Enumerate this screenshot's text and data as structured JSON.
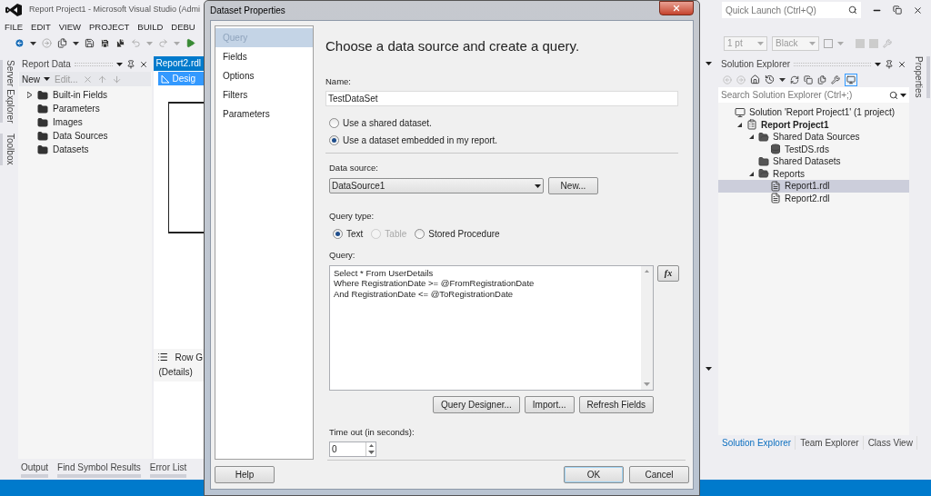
{
  "vs": {
    "title": "Report Project1 - Microsoft Visual Studio (Admi",
    "menu": [
      "FILE",
      "EDIT",
      "VIEW",
      "PROJECT",
      "BUILD",
      "DEBU"
    ],
    "quick_launch": {
      "placeholder": "Quick Launch (Ctrl+Q)"
    },
    "font_size": "1 pt",
    "font_color": "Black",
    "left_tabs": [
      "Server Explorer",
      "Toolbox"
    ],
    "report_data": {
      "title": "Report Data",
      "new": "New",
      "edit": "Edit...",
      "items": [
        {
          "label": "Built-in Fields",
          "expandable": true
        },
        {
          "label": "Parameters",
          "expandable": false
        },
        {
          "label": "Images",
          "expandable": false
        },
        {
          "label": "Data Sources",
          "expandable": false
        },
        {
          "label": "Datasets",
          "expandable": false
        }
      ]
    },
    "document": {
      "tab": "Report2.rdl",
      "design_tab": "Desig",
      "row_groups": "Row G",
      "details": "(Details)"
    },
    "bottom_tabs": [
      "Output",
      "Find Symbol Results",
      "Error List"
    ],
    "solution_explorer": {
      "title": "Solution Explorer",
      "search": {
        "placeholder": "Search Solution Explorer (Ctrl+;)"
      },
      "tree": [
        {
          "label": "Solution 'Report Project1' (1 project)",
          "kind": "solution",
          "selected": false,
          "children": [
            {
              "label": "Report Project1",
              "kind": "project",
              "selected": false,
              "expanded": true,
              "children": [
                {
                  "label": "Shared Data Sources",
                  "kind": "folder",
                  "selected": false,
                  "expanded": true,
                  "children": [
                    {
                      "label": "TestDS.rds",
                      "kind": "datasource",
                      "selected": false
                    }
                  ]
                },
                {
                  "label": "Shared Datasets",
                  "kind": "folder",
                  "selected": false
                },
                {
                  "label": "Reports",
                  "kind": "folder",
                  "selected": false,
                  "expanded": true,
                  "children": [
                    {
                      "label": "Report1.rdl",
                      "kind": "report",
                      "selected": true
                    },
                    {
                      "label": "Report2.rdl",
                      "kind": "report",
                      "selected": false
                    }
                  ]
                }
              ]
            }
          ]
        }
      ],
      "tabs": [
        {
          "label": "Solution Explorer",
          "selected": true
        },
        {
          "label": "Team Explorer",
          "selected": false
        },
        {
          "label": "Class View",
          "selected": false
        }
      ]
    },
    "right_tabs": [
      "Properties"
    ]
  },
  "dialog": {
    "title": "Dataset Properties",
    "nav": [
      {
        "label": "Query",
        "selected": true
      },
      {
        "label": "Fields",
        "selected": false
      },
      {
        "label": "Options",
        "selected": false
      },
      {
        "label": "Filters",
        "selected": false
      },
      {
        "label": "Parameters",
        "selected": false
      }
    ],
    "heading": "Choose a data source and create a query.",
    "name_label": "Name:",
    "name": "TestDataSet",
    "dataset_options": [
      {
        "label": "Use a shared dataset.",
        "selected": false
      },
      {
        "label": "Use a dataset embedded in my report.",
        "selected": true
      }
    ],
    "data_source_label": "Data source:",
    "data_source": "DataSource1",
    "new_button": "New...",
    "query_type_label": "Query type:",
    "query_types": [
      {
        "label": "Text",
        "selected": true,
        "disabled": false
      },
      {
        "label": "Table",
        "selected": false,
        "disabled": true
      },
      {
        "label": "Stored Procedure",
        "selected": false,
        "disabled": false
      }
    ],
    "query_label": "Query:",
    "query_lines": [
      "Select * From UserDetails",
      "Where RegistrationDate >= @FromRegistrationDate",
      "And RegistrationDate <= @ToRegistrationDate"
    ],
    "expression_button": "fx",
    "query_buttons": [
      "Query Designer...",
      "Import...",
      "Refresh Fields"
    ],
    "timeout_label": "Time out (in seconds):",
    "timeout": "0",
    "help_button": "Help",
    "ok_button": "OK",
    "cancel_button": "Cancel"
  }
}
